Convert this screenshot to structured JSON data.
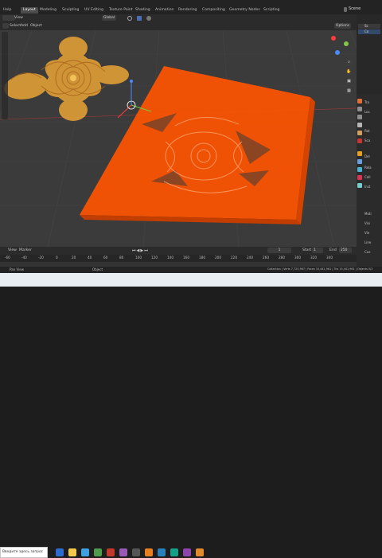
{
  "topbar": {
    "help": "Help",
    "workspaces": [
      "Layout",
      "Modeling",
      "Sculpting",
      "UV Editing",
      "Texture Paint",
      "Shading",
      "Animation",
      "Rendering",
      "Compositing",
      "Geometry Nodes",
      "Scripting"
    ],
    "scene": "Scene"
  },
  "header": {
    "mode": "Object Mode",
    "view": "View",
    "select": "Select",
    "add": "Add",
    "object": "Object",
    "orientation": "Global",
    "options": "Options",
    "select_box": "Select Box"
  },
  "timeline": {
    "playback": "Playback",
    "keying": "Keying",
    "view": "View",
    "marker": "Marker",
    "current_frame": "1",
    "start_label": "Start",
    "start": "1",
    "end_label": "End",
    "end": "250",
    "ticks": [
      "-60",
      "-40",
      "-20",
      "0",
      "20",
      "40",
      "60",
      "80",
      "100",
      "120",
      "140",
      "160",
      "180",
      "200",
      "220",
      "240",
      "260",
      "280",
      "300",
      "320",
      "340"
    ]
  },
  "status": {
    "left": "Pan View",
    "mid": "Object",
    "right": "Collection | Verts 7,720,967 | Faces 15,441,961 | Tris 15,441,961 | Objects 0/2"
  },
  "taskbar": {
    "search_placeholder": "Введите здесь запрос"
  },
  "outliner": {
    "items": [
      "Sc",
      "Co"
    ]
  },
  "properties": {
    "rows": [
      "Tra",
      "Loc",
      "Rot",
      "Sca",
      "Del",
      "Rela",
      "Coll",
      "Inst",
      "Moti",
      "Visi",
      "Vie",
      "Line",
      "Cus"
    ]
  }
}
